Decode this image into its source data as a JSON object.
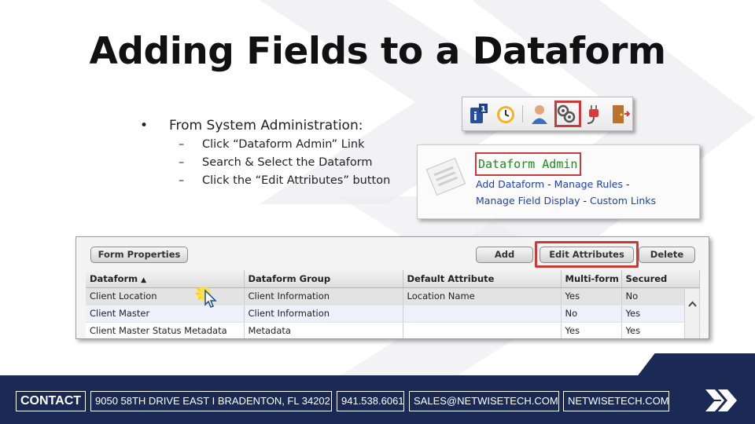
{
  "slide": {
    "title": "Adding Fields to a Dataform"
  },
  "bullets": {
    "main": "From System Administration:",
    "sub": [
      "Click “Dataform Admin” Link",
      "Search & Select the Dataform",
      "Click the “Edit Attributes” button"
    ]
  },
  "toolbar": {
    "icons": [
      "help-one-icon",
      "clock-icon",
      "user-icon",
      "admin-gears-icon",
      "plug-icon",
      "exit-door-icon"
    ]
  },
  "admin_panel": {
    "title": "Dataform Admin",
    "links": {
      "add_dataform": "Add Dataform",
      "manage_rules": "Manage Rules",
      "manage_field_display": "Manage Field Display",
      "custom_links": "Custom Links",
      "separator": "-"
    }
  },
  "grid": {
    "buttons": {
      "form_properties": "Form Properties",
      "add": "Add",
      "edit_attributes": "Edit Attributes",
      "delete": "Delete"
    },
    "sort_indicator": "▲",
    "columns": [
      "Dataform",
      "Dataform Group",
      "Default Attribute",
      "Multi-form",
      "Secured"
    ],
    "rows": [
      [
        "Client Location",
        "Client Information",
        "Location Name",
        "Yes",
        "No"
      ],
      [
        "Client Master",
        "Client Information",
        "",
        "No",
        "Yes"
      ],
      [
        "Client Master Status Metadata",
        "Metadata",
        "",
        "Yes",
        "Yes"
      ]
    ]
  },
  "footer": {
    "contact": "CONTACT",
    "address": "9050 58TH DRIVE EAST I BRADENTON, FL 34202",
    "phone": "941.538.6061",
    "email": "SALES@NETWISETECH.COM",
    "website": "NETWISETECH.COM"
  },
  "colors": {
    "highlight": "#c93a3a",
    "link": "#1e3fae",
    "admin_title": "#1f8a1f",
    "footer": "#1a2a55"
  }
}
